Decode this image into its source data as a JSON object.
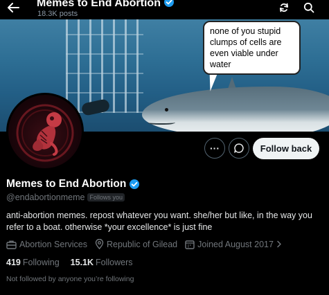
{
  "header": {
    "title": "Memes to End Abortion",
    "posts_count": "18.3K posts"
  },
  "banner": {
    "speech_bubble_text": "none of you stupid clumps of cells are even viable under water"
  },
  "actions": {
    "more_label": "···",
    "follow_back_label": "Follow back"
  },
  "profile": {
    "display_name": "Memes to End Abortion",
    "handle": "@endabortionmeme",
    "follows_you_badge": "Follows you",
    "bio": "anti-abortion memes. repost whatever you want. she/her but like, in the way you refer to a boat. otherwise *your excellence* is just fine",
    "category": "Abortion Services",
    "location": "Republic of Gilead",
    "joined": "Joined August 2017",
    "following_count": "419",
    "following_label": "Following",
    "followers_count": "15.1K",
    "followers_label": "Followers",
    "not_followed_note": "Not followed by anyone you’re following"
  },
  "colors": {
    "background": "#000000",
    "verified_badge": "#1d9bf0",
    "muted_text": "#71767b",
    "follow_button_bg": "#eff3f4"
  },
  "icons": {
    "back": "arrow-left-icon",
    "verified": "verified-badge-icon",
    "alt_top": "refresh-icon",
    "search": "search-icon",
    "more": "more-icon",
    "message": "message-icon",
    "category": "briefcase-icon",
    "location": "location-pin-icon",
    "joined": "calendar-icon",
    "expand": "chevron-right-icon"
  }
}
